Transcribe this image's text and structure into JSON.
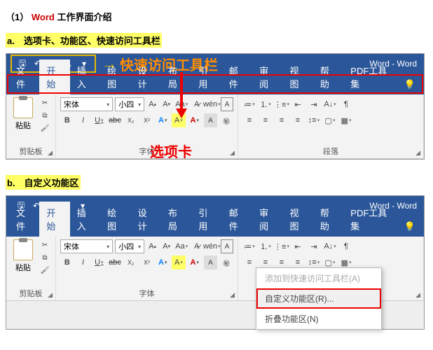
{
  "doc": {
    "heading_num": "（1）",
    "heading_app": "Word",
    "heading_rest": "工作界面介绍",
    "sub_a": "a.　选项卡、功能区、快速访问工具栏",
    "sub_b": "b.　自定义功能区"
  },
  "annotations": {
    "qat_label": "快速访问工具栏",
    "tabs_label": "选项卡"
  },
  "window": {
    "title": "Word  -  Word",
    "tabs": [
      "文件",
      "开始",
      "插入",
      "绘图",
      "设计",
      "布局",
      "引用",
      "邮件",
      "审阅",
      "视图",
      "帮助",
      "PDF工具集"
    ],
    "active_tab_index": 1
  },
  "ribbon": {
    "clipboard": {
      "label": "剪贴板",
      "paste": "粘贴"
    },
    "font": {
      "label": "字体",
      "font_name": "宋体",
      "font_size": "小四",
      "btns_row1": [
        "A",
        "A",
        "Aa",
        "A",
        "wén",
        "A"
      ],
      "btns_row2": [
        "B",
        "I",
        "U",
        "abc",
        "X₂",
        "X²",
        "A",
        "A",
        "A",
        "A"
      ]
    },
    "paragraph": {
      "label": "段落"
    }
  },
  "context_menu": {
    "items": [
      {
        "label": "添加到快速访问工具栏(A)",
        "state": "disabled"
      },
      {
        "label": "自定义功能区(R)...",
        "state": "highlighted"
      },
      {
        "label": "折叠功能区(N)",
        "state": "normal"
      }
    ]
  }
}
